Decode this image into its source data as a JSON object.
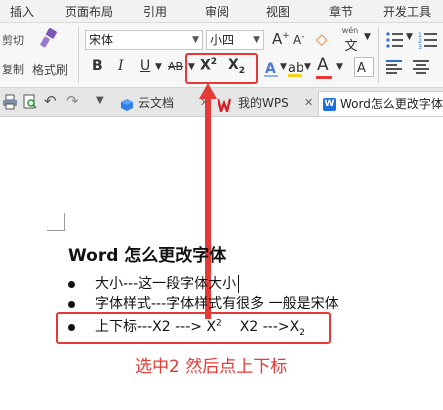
{
  "menu": [
    "插入",
    "页面布局",
    "引用",
    "审阅",
    "视图",
    "章节",
    "开发工具"
  ],
  "ribbon": {
    "cut_label": "剪切",
    "copy_label": "复制",
    "format_painter_label": "格式刷",
    "font_name": "宋体",
    "font_size": "小四",
    "bold": "B",
    "italic": "I",
    "underline": "U",
    "strike": "AB",
    "superscript": "X",
    "superscript_mark": "2",
    "subscript": "X",
    "subscript_mark": "2",
    "font_color": "A",
    "grow_font": "A",
    "shrink_font": "A",
    "wen_label": "wén",
    "wen_char": "文"
  },
  "tabs": [
    {
      "label": "云文档"
    },
    {
      "label": "我的WPS"
    },
    {
      "label": "Word怎么更改字体"
    }
  ],
  "document": {
    "heading": "Word 怎么更改字体",
    "line1": "大小---这一段字体大小",
    "line2": "字体样式---字体样式有很多  一般是宋体",
    "line3_prefix": "上下标---X2 ---> X",
    "line3_sup": "2",
    "line3_mid": "X2 --->X",
    "line3_sub": "2"
  },
  "annotation": "选中2 然后点上下标",
  "colors": {
    "highlight_red": "#e53935",
    "font_color_red": "#e53935",
    "tab_active_blue": "#1e6fd9",
    "wps_red": "#d71f26"
  },
  "icons": {
    "format_painter": "broom-icon",
    "print": "print-icon",
    "preview": "print-preview-icon",
    "undo": "undo-icon",
    "redo": "redo-icon",
    "cloud_doc": "cloud-doc-icon",
    "wps": "wps-logo-icon",
    "word_doc": "word-doc-icon"
  }
}
